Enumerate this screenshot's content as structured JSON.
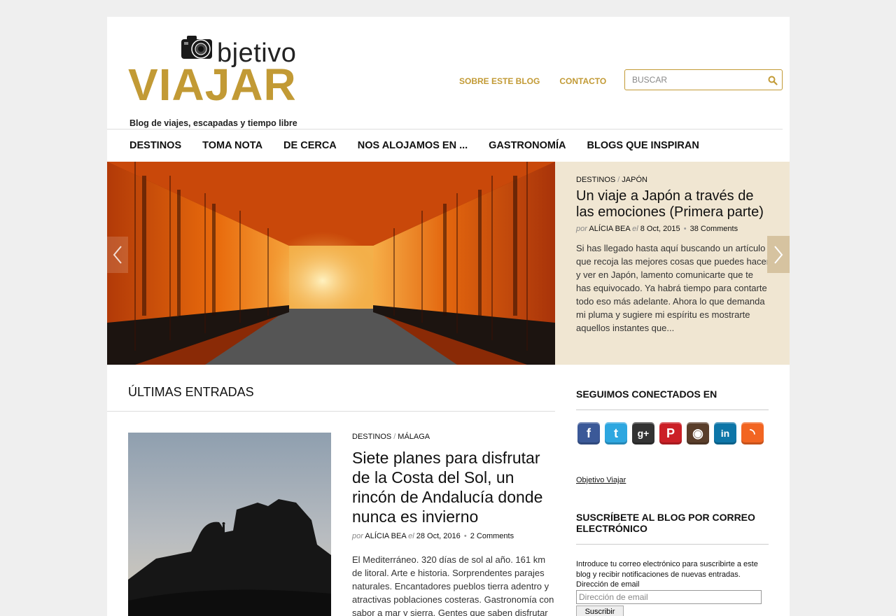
{
  "header": {
    "brand_top": "bjetivo",
    "brand_main": "VIAJAR",
    "tagline": "Blog de viajes, escapadas y tiempo libre",
    "links": [
      "SOBRE ESTE BLOG",
      "CONTACTO"
    ],
    "search_placeholder": "BUSCAR"
  },
  "nav": [
    "DESTINOS",
    "TOMA NOTA",
    "DE CERCA",
    "NOS ALOJAMOS EN ...",
    "GASTRONOMÍA",
    "BLOGS QUE INSPIRAN"
  ],
  "featured": {
    "cat1": "DESTINOS",
    "cat2": "JAPÓN",
    "title": "Un viaje a Japón a través de las emociones (Primera parte)",
    "por": "por",
    "author": "ALÍCIA BEA",
    "el": "el",
    "date": "8 Oct, 2015",
    "comments": "38 Comments",
    "excerpt": "Si has llegado hasta aquí buscando un artículo que recoja las mejores cosas que puedes hacer y ver en Japón, lamento comunicarte que te has equivocado. Ya habrá tiempo para contarte todo eso más adelante. Ahora lo que demanda mi pluma y sugiere mi espíritu es mostrarte aquellos instantes que..."
  },
  "latest": {
    "section_title": "ÚLTIMAS ENTRADAS",
    "post": {
      "cat1": "DESTINOS",
      "cat2": "MÁLAGA",
      "title": "Siete planes para disfrutar de la Costa del Sol, un rincón de Andalucía donde nunca es invierno",
      "por": "por",
      "author": "ALÍCIA BEA",
      "el": "el",
      "date": "28 Oct, 2016",
      "comments": "2 Comments",
      "excerpt": "El Mediterráneo. 320 días de sol al año. 161 km de litoral. Arte e historia. Sorprendentes parajes naturales. Encantadores pueblos tierra adentro y atractivas poblaciones costeras. Gastronomía con sabor a mar y sierra. Gentes que saben disfrutar"
    }
  },
  "sidebar": {
    "connect_title": "SEGUIMOS CONECTADOS EN",
    "socials": [
      {
        "name": "facebook-icon",
        "glyph": "f",
        "color": "#3b5998"
      },
      {
        "name": "twitter-icon",
        "glyph": "t",
        "color": "#2ea7e0"
      },
      {
        "name": "google-plus-icon",
        "glyph": "g+",
        "color": "#333333"
      },
      {
        "name": "pinterest-icon",
        "glyph": "P",
        "color": "#cb2027"
      },
      {
        "name": "instagram-icon",
        "glyph": "◉",
        "color": "#5a3e2b"
      },
      {
        "name": "linkedin-icon",
        "glyph": "in",
        "color": "#0e76a8"
      },
      {
        "name": "rss-icon",
        "glyph": "◝",
        "color": "#f26522"
      }
    ],
    "blog_link": "Objetivo Viajar",
    "subscribe_title": "SUSCRÍBETE AL BLOG POR CORREO ELECTRÓNICO",
    "subscribe_text": "Introduce tu correo electrónico para suscribirte a este blog y recibir notificaciones de nuevas entradas.",
    "email_label": "Dirección de email",
    "email_placeholder": "Dirección de email",
    "button_label": "Suscribir"
  },
  "colors": {
    "accent": "#c29a35",
    "panel": "#f0e6d2"
  }
}
